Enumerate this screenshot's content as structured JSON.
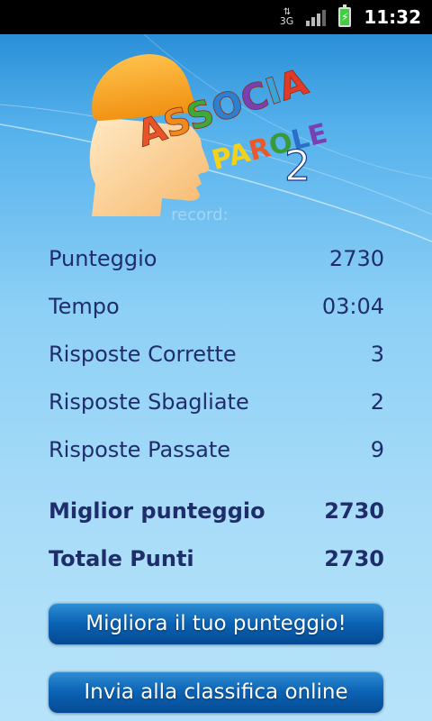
{
  "status_bar": {
    "network": "3G",
    "time": "11:32",
    "battery_color": "#44cc44"
  },
  "logo": {
    "word1": "ASSOCIA",
    "word2": "PAROLE",
    "number": "2",
    "head_color": "#f7c27a",
    "brain_color": "#f5a21c"
  },
  "ghost_text": "record:",
  "stats": [
    {
      "label": "Punteggio",
      "value": "2730"
    },
    {
      "label": "Tempo",
      "value": "03:04"
    },
    {
      "label": "Risposte Corrette",
      "value": "3"
    },
    {
      "label": "Risposte Sbagliate",
      "value": "2"
    },
    {
      "label": "Risposte Passate",
      "value": "9"
    }
  ],
  "totals": [
    {
      "label": "Miglior punteggio",
      "value": "2730"
    },
    {
      "label": "Totale Punti",
      "value": "2730"
    }
  ],
  "buttons": {
    "improve": "Migliora il tuo punteggio!",
    "submit": "Invia alla classifica online"
  }
}
